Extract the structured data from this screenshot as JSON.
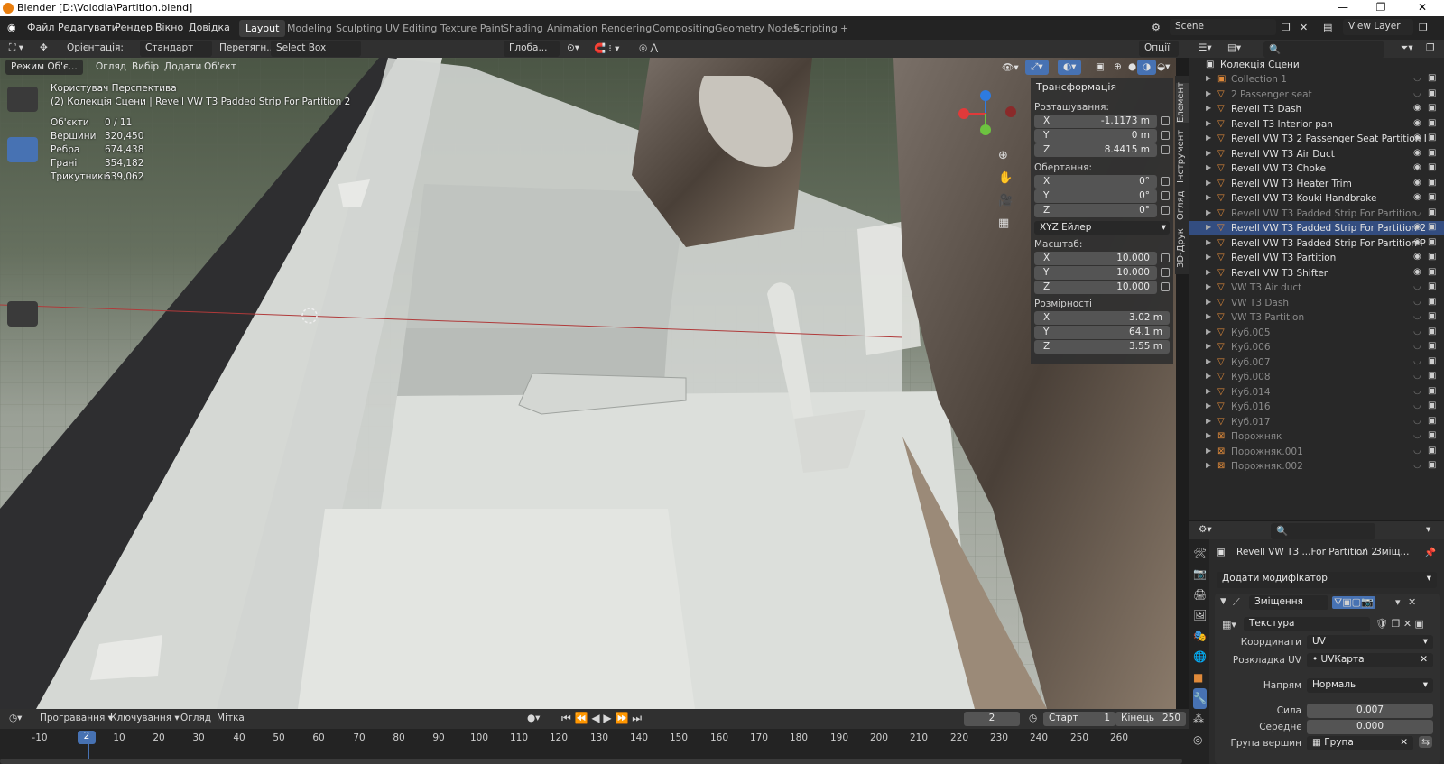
{
  "window": {
    "title": "Blender [D:\\Volodia\\Partition.blend]",
    "minimize": "—",
    "maximize": "❐",
    "close": "✕"
  },
  "menu": [
    "Файл",
    "Редагувати",
    "Рендер",
    "Вікно",
    "Довідка"
  ],
  "workspaces": [
    "Layout",
    "Modeling",
    "Sculpting",
    "UV Editing",
    "Texture Paint",
    "Shading",
    "Animation",
    "Rendering",
    "Compositing",
    "Geometry Nodes",
    "Scripting"
  ],
  "active_workspace": "Layout",
  "scene": {
    "name": "Scene",
    "view_layer": "View Layer"
  },
  "tool_header": {
    "orientation_label": "Орієнтація:",
    "orientation_value": "Стандарт",
    "drag_label": "Перетягн...",
    "drag_value": "Select Box",
    "transform_orientation": "Глоба...",
    "options": "Опції"
  },
  "viewport_header": {
    "mode": "Режим Об'є...",
    "view": "Огляд",
    "select": "Вибір",
    "add": "Додати",
    "object": "Об'єкт"
  },
  "viewport_info": {
    "perspective": "Користувач Перспектива",
    "collection": "(2) Колекція Сцени | Revell VW T3 Padded Strip For Partition 2",
    "stats": [
      {
        "label": "Об'єкти",
        "value": "0 / 11"
      },
      {
        "label": "Вершини",
        "value": "320,450"
      },
      {
        "label": "Ребра",
        "value": "674,438"
      },
      {
        "label": "Грані",
        "value": "354,182"
      },
      {
        "label": "Трикутники",
        "value": "639,062"
      }
    ]
  },
  "transform_panel": {
    "title": "Трансформація",
    "location_label": "Розташування:",
    "location": [
      {
        "k": "X",
        "v": "-1.1173 m"
      },
      {
        "k": "Y",
        "v": "0 m"
      },
      {
        "k": "Z",
        "v": "8.4415 m"
      }
    ],
    "rotation_label": "Обертання:",
    "rotation": [
      {
        "k": "X",
        "v": "0°"
      },
      {
        "k": "Y",
        "v": "0°"
      },
      {
        "k": "Z",
        "v": "0°"
      }
    ],
    "rotation_mode": "XYZ Ейлер",
    "scale_label": "Масштаб:",
    "scale": [
      {
        "k": "X",
        "v": "10.000"
      },
      {
        "k": "Y",
        "v": "10.000"
      },
      {
        "k": "Z",
        "v": "10.000"
      }
    ],
    "dimensions_label": "Розмірності",
    "dimensions": [
      {
        "k": "X",
        "v": "3.02 m"
      },
      {
        "k": "Y",
        "v": "64.1 m"
      },
      {
        "k": "Z",
        "v": "3.55 m"
      }
    ]
  },
  "sidebar_tabs": [
    "Елемент",
    "Інструмент",
    "Огляд",
    "3D-Друк"
  ],
  "outliner": {
    "root": "Колекція Сцени",
    "items": [
      {
        "name": "Collection 1",
        "dim": true,
        "sel": false
      },
      {
        "name": "2 Passenger seat",
        "dim": true,
        "sel": false
      },
      {
        "name": "Revell T3 Dash",
        "dim": false,
        "sel": false
      },
      {
        "name": "Revell T3 Interior pan",
        "dim": false,
        "sel": false
      },
      {
        "name": "Revell VW T3 2 Passenger Seat Partition I",
        "dim": false,
        "sel": false
      },
      {
        "name": "Revell VW T3 Air Duct",
        "dim": false,
        "sel": false
      },
      {
        "name": "Revell VW T3 Choke",
        "dim": false,
        "sel": false
      },
      {
        "name": "Revell VW T3 Heater Trim",
        "dim": false,
        "sel": false
      },
      {
        "name": "Revell VW T3 Kouki Handbrake",
        "dim": false,
        "sel": false
      },
      {
        "name": "Revell VW T3 Padded Strip For Partition",
        "dim": true,
        "sel": false
      },
      {
        "name": "Revell VW T3 Padded Strip For Partition 2",
        "dim": false,
        "sel": true
      },
      {
        "name": "Revell VW T3 Padded Strip For Partition P",
        "dim": false,
        "sel": false
      },
      {
        "name": "Revell VW T3 Partition",
        "dim": false,
        "sel": false
      },
      {
        "name": "Revell VW T3 Shifter",
        "dim": false,
        "sel": false
      },
      {
        "name": "VW T3 Air duct",
        "dim": true,
        "sel": false
      },
      {
        "name": "VW T3 Dash",
        "dim": true,
        "sel": false
      },
      {
        "name": "VW T3 Partition",
        "dim": true,
        "sel": false
      },
      {
        "name": "Куб.005",
        "dim": true,
        "sel": false
      },
      {
        "name": "Куб.006",
        "dim": true,
        "sel": false
      },
      {
        "name": "Куб.007",
        "dim": true,
        "sel": false
      },
      {
        "name": "Куб.008",
        "dim": true,
        "sel": false
      },
      {
        "name": "Куб.014",
        "dim": true,
        "sel": false
      },
      {
        "name": "Куб.016",
        "dim": true,
        "sel": false
      },
      {
        "name": "Куб.017",
        "dim": true,
        "sel": false
      },
      {
        "name": "Порожняк",
        "dim": true,
        "sel": false
      },
      {
        "name": "Порожняк.001",
        "dim": true,
        "sel": false
      },
      {
        "name": "Порожняк.002",
        "dim": true,
        "sel": false
      }
    ]
  },
  "properties": {
    "object_name": "Revell VW T3 ...For Partition 2",
    "modifier_tab": "Зміщ...",
    "add_modifier": "Додати модифікатор",
    "modifier_name": "Зміщення",
    "texture": "Текстура",
    "coords_label": "Координати",
    "coords_value": "UV",
    "uv_label": "Розкладка UV",
    "uv_value": "UVКарта",
    "direction_label": "Напрям",
    "direction_value": "Нормаль",
    "strength_label": "Сила",
    "strength_value": "0.007",
    "midlevel_label": "Середнє",
    "midlevel_value": "0.000",
    "vgroup_label": "Група вершин",
    "vgroup_value": "Група"
  },
  "timeline": {
    "playback": "Програвання",
    "keying": "Ключування",
    "view": "Огляд",
    "marker": "Мітка",
    "current_frame": "2",
    "start_label": "Старт",
    "start": "1",
    "end_label": "Кінець",
    "end": "250",
    "ticks": [
      "-10",
      "2",
      "10",
      "20",
      "30",
      "40",
      "50",
      "60",
      "70",
      "80",
      "90",
      "100",
      "110",
      "120",
      "130",
      "140",
      "150",
      "160",
      "170",
      "180",
      "190",
      "200",
      "210",
      "220",
      "230",
      "240",
      "250",
      "260"
    ]
  }
}
